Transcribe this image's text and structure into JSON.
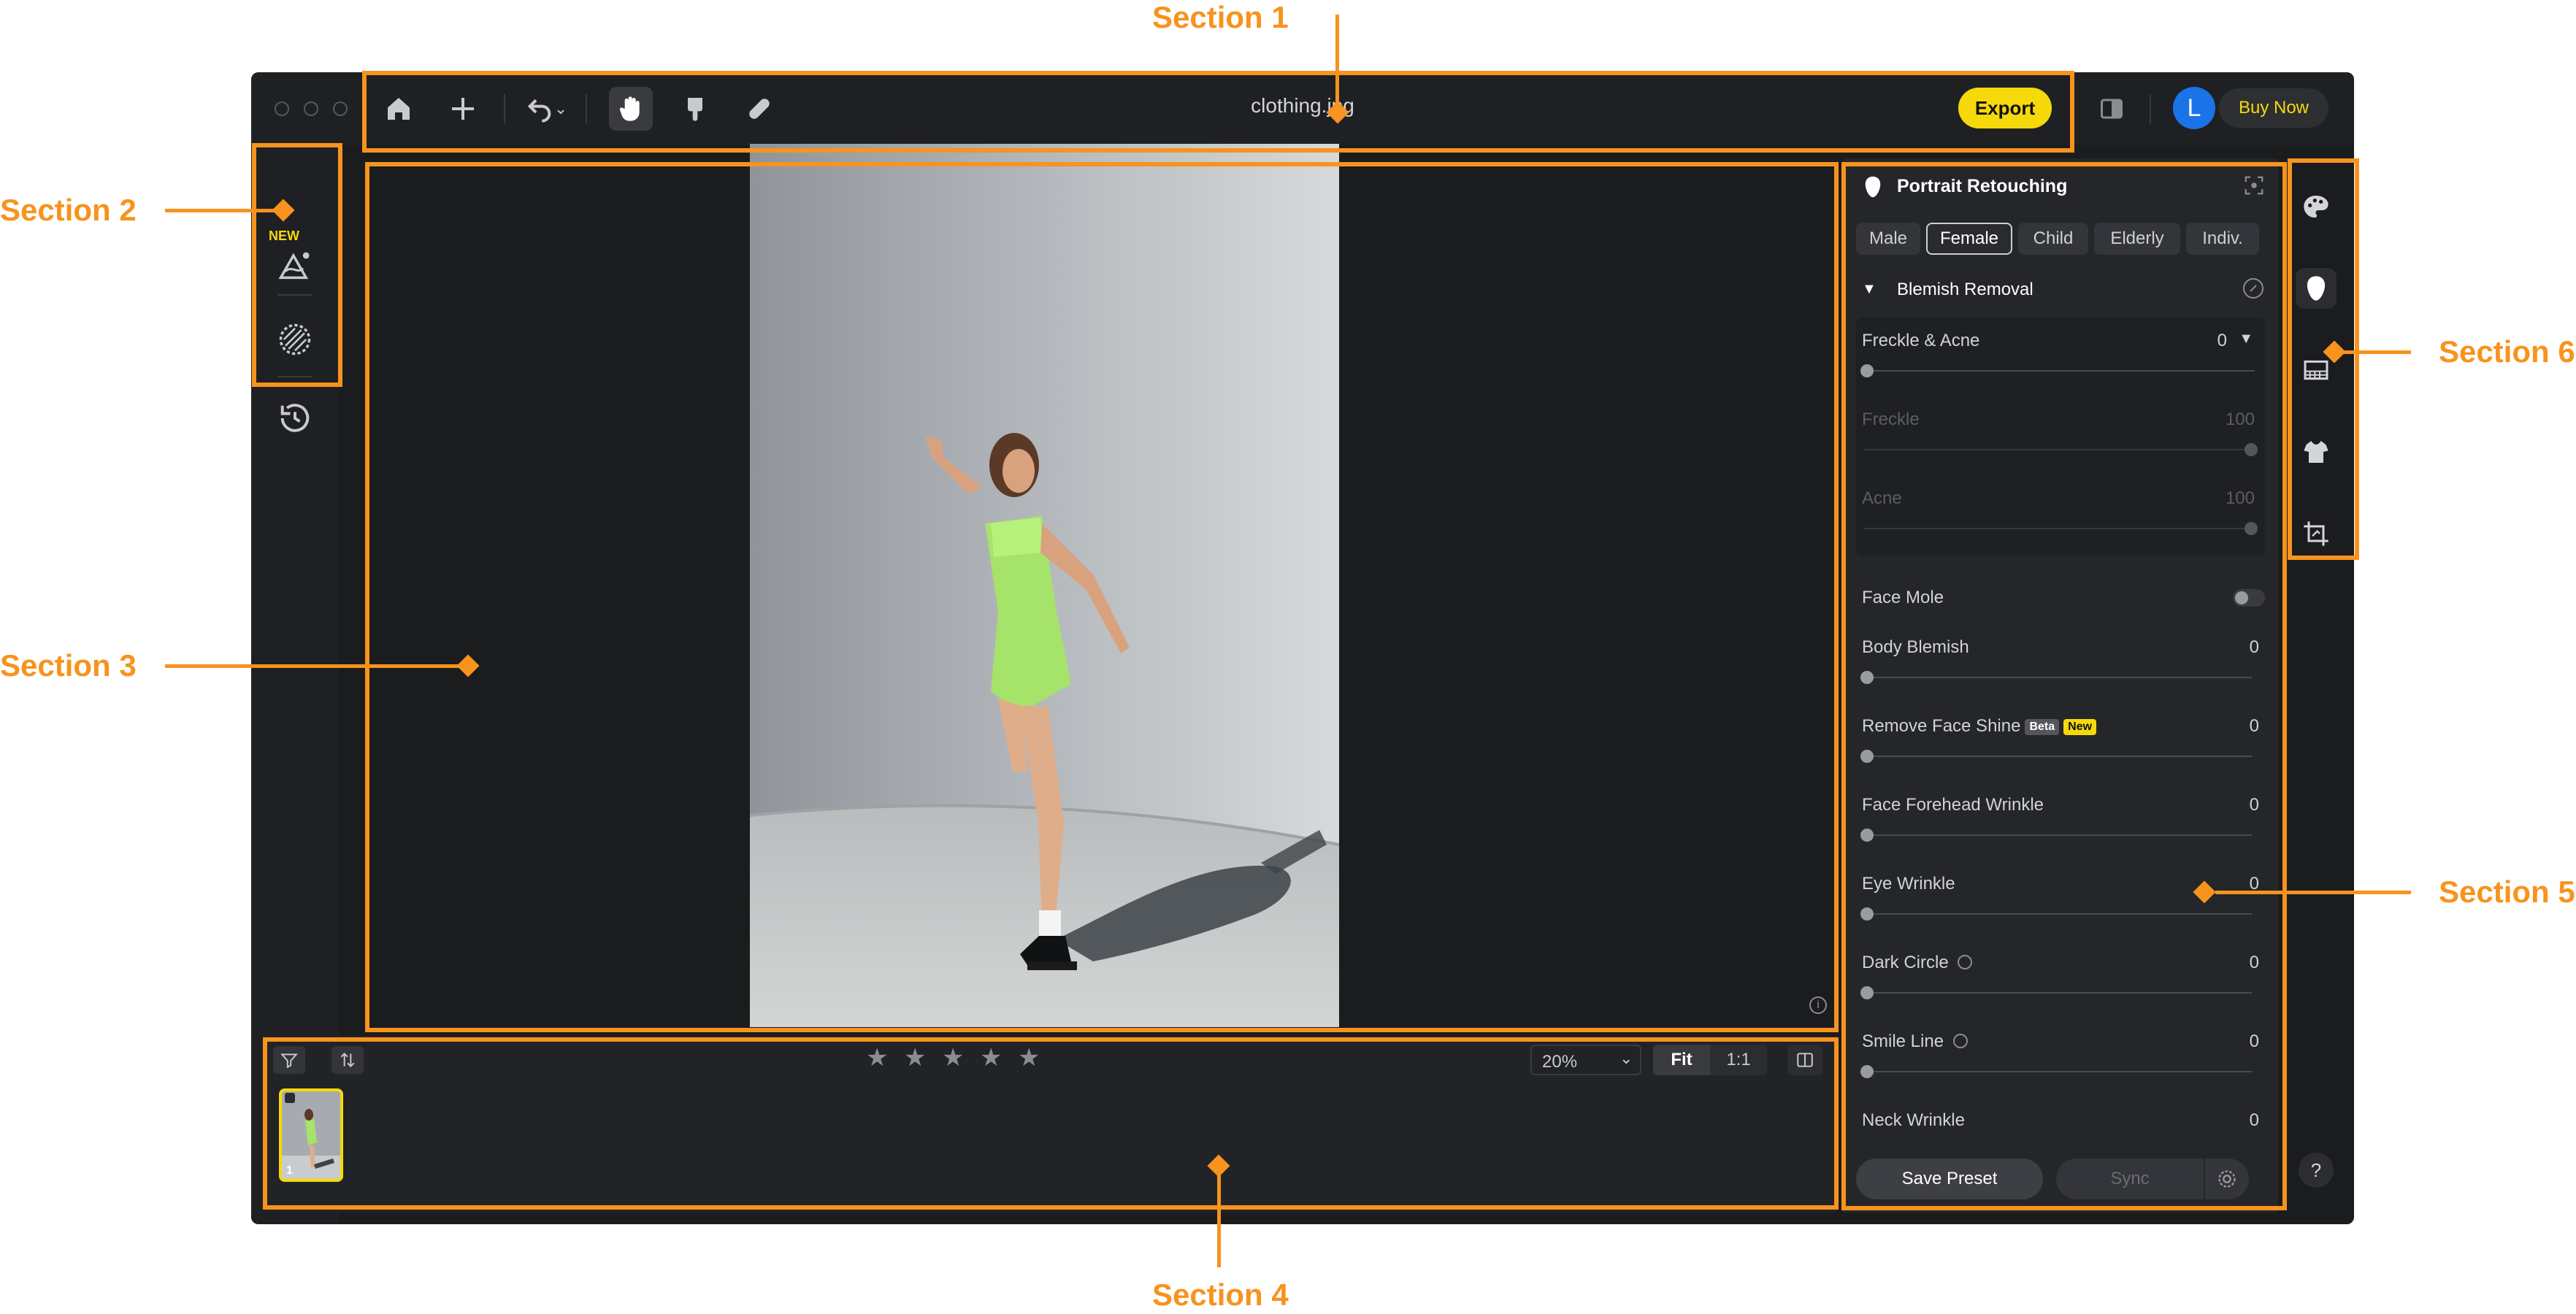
{
  "callouts": {
    "section1": "Section 1",
    "section2": "Section 2",
    "section3": "Section 3",
    "section4": "Section 4",
    "section5": "Section 5",
    "section6": "Section 6"
  },
  "titlebar": {
    "filename": "clothing.jpg",
    "export_label": "Export",
    "avatar_letter": "L",
    "buy_now_label": "Buy Now",
    "icons": [
      "home-icon",
      "plus-icon",
      "undo-icon",
      "hand-icon",
      "brush-icon",
      "bandage-icon"
    ]
  },
  "left_tools": {
    "new_badge": "NEW",
    "icons": [
      "ai-color-icon",
      "texture-circle-icon",
      "history-icon"
    ]
  },
  "filmstrip": {
    "zoom_value": "20%",
    "fit_label": "Fit",
    "one_to_one_label": "1:1",
    "thumb_index": "1",
    "star_count": 5
  },
  "right_panel": {
    "title": "Portrait Retouching",
    "subject_tabs": [
      "Male",
      "Female",
      "Child",
      "Elderly",
      "Indiv."
    ],
    "selected_tab": "Female",
    "section_title": "Blemish Removal",
    "freckle_acne": {
      "label": "Freckle & Acne",
      "value": "0"
    },
    "freckle": {
      "label": "Freckle",
      "value": "100"
    },
    "acne": {
      "label": "Acne",
      "value": "100"
    },
    "face_mole": {
      "label": "Face Mole"
    },
    "sliders": [
      {
        "label": "Body Blemish",
        "value": "0"
      },
      {
        "label": "Remove Face Shine",
        "value": "0",
        "badges": [
          "Beta",
          "New"
        ]
      },
      {
        "label": "Face Forehead Wrinkle",
        "value": "0"
      },
      {
        "label": "Eye Wrinkle",
        "value": "0"
      },
      {
        "label": "Dark Circle",
        "value": "0"
      },
      {
        "label": "Smile Line",
        "value": "0"
      },
      {
        "label": "Neck Wrinkle",
        "value": "0"
      }
    ],
    "save_preset_label": "Save Preset",
    "sync_label": "Sync"
  },
  "rail": {
    "icons": [
      "palette-icon",
      "face-icon",
      "background-icon",
      "clothing-icon",
      "crop-icon"
    ],
    "help_label": "?"
  },
  "colors": {
    "accent_orange": "#F7931E",
    "export_yellow": "#F5D90A",
    "app_bg": "#1B1C1E",
    "avatar_blue": "#1A73E8"
  }
}
